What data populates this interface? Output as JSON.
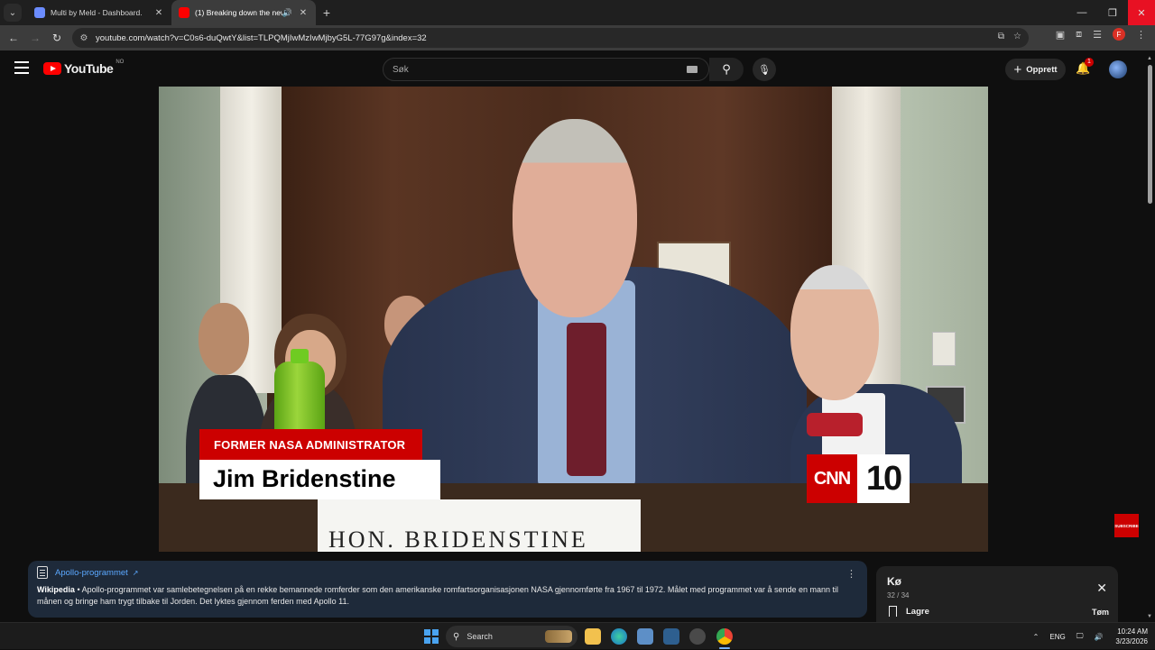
{
  "browser": {
    "tabs": [
      {
        "title": "Multi by Meld - Dashboard."
      },
      {
        "title": "(1) Breaking down the new"
      }
    ],
    "url": "youtube.com/watch?v=C0s6-duQwtY&list=TLPQMjIwMzIwMjbyG5L-77G97g&index=32",
    "profile_initial": "F"
  },
  "youtube": {
    "logo_text": "YouTube",
    "country_code": "NO",
    "search_placeholder": "Søk",
    "create_label": "Opprett",
    "notification_count": "1"
  },
  "video": {
    "lower_third_title": "FORMER NASA ADMINISTRATOR",
    "lower_third_name": "Jim Bridenstine",
    "nameplate": "HON. BRIDENSTINE",
    "brand_left": "CNN",
    "brand_right": "10",
    "subscribe_label": "SUBSCRIBE"
  },
  "info_panel": {
    "title": "Apollo-programmet",
    "source": "Wikipedia",
    "text": "Apollo-programmet var samlebetegnelsen på en rekke bemannede romferder som den amerikanske romfartsorganisasjonen NASA gjennomførte fra 1967 til 1972. Målet med programmet var å sende en mann til månen og bringe ham trygt tilbake til Jorden. Det lyktes gjennom ferden med Apollo 11."
  },
  "queue": {
    "title": "Kø",
    "count": "32 / 34",
    "save_label": "Lagre",
    "clear_label": "Tøm"
  },
  "taskbar": {
    "search_label": "Search",
    "language": "ENG",
    "time": "10:24 AM",
    "date": "3/23/2026"
  },
  "colors": {
    "yt_red": "#ff0000",
    "cnn_red": "#cc0000",
    "link_blue": "#5ba8ff"
  }
}
